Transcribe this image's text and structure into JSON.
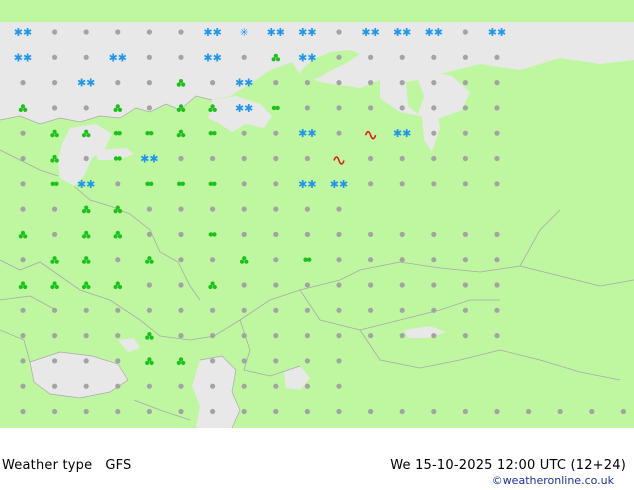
{
  "map": {
    "product": "Weather type",
    "model": "GFS",
    "valid_time": "We 15-10-2025 12:00 UTC (12+24)",
    "credit": "©weatheronline.co.uk",
    "colors": {
      "land": "#bff7a0",
      "sea": "#e8e8e8",
      "border": "#a9a9a9",
      "clear": "#a3a3a3",
      "rain": "#19c219",
      "snow": "#1e96ee",
      "thunder": "#e31a1a"
    },
    "legend_classes": [
      "clear",
      "cloudy",
      "overcast",
      "drizzle",
      "light-rain",
      "rain-showers",
      "rain",
      "snow-showers",
      "snow",
      "freezing-rain"
    ],
    "symbols": [
      "S.....SxSS.SSS.S",
      "S..S..S.RS......",
      "..S..R.S........",
      "R..R.RRSr.......",
      ".RRrrRr..S.TS...",
      ".R.rS.....T.....",
      ".rS.rrr..SS.....",
      "..RR.......",
      "R.RR..r.........",
      ".RR.R..R.r......",
      "RRRR..R.........",
      "................",
      "....R...........",
      "....RR.....",
      "...........",
      "......................"
    ]
  }
}
